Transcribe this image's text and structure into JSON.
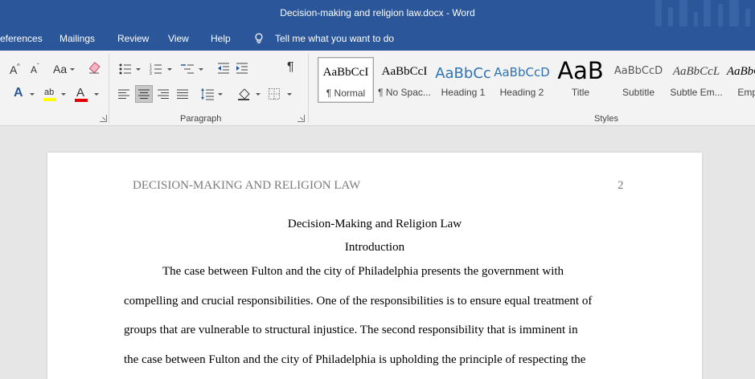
{
  "window": {
    "title": "Decision-making and religion law.docx  -  Word"
  },
  "tabs": {
    "references": "eferences",
    "mailings": "Mailings",
    "review": "Review",
    "view": "View",
    "help": "Help",
    "tell_me": "Tell me what you want to do"
  },
  "ribbon": {
    "font_group": {
      "grow_font": "A",
      "change_case": "Aa",
      "text_effects": "A",
      "highlight": "ab",
      "font_color": "A"
    },
    "paragraph_group": {
      "label": "Paragraph",
      "pilcrow": "¶"
    },
    "styles_group": {
      "label": "Styles",
      "items": [
        {
          "sample": "AaBbCcI",
          "name": "¶ Normal"
        },
        {
          "sample": "AaBbCcI",
          "name": "¶ No Spac..."
        },
        {
          "sample": "AaBbCc",
          "name": "Heading 1"
        },
        {
          "sample": "AaBbCcD",
          "name": "Heading 2"
        },
        {
          "sample": "AaB",
          "name": "Title"
        },
        {
          "sample": "AaBbCcD",
          "name": "Subtitle"
        },
        {
          "sample": "AaBbCcL",
          "name": "Subtle Em..."
        },
        {
          "sample": "AaBbCcL",
          "name": "Emph"
        }
      ]
    },
    "colors": {
      "highlight": "#ffff00",
      "font_color": "#e00000",
      "text_effects": "#2b579a",
      "heading_blue": "#2e74b5"
    }
  },
  "document": {
    "header": "DECISION-MAKING AND RELIGION LAW",
    "page_number": "2",
    "title": "Decision-Making and Religion Law",
    "heading": "Introduction",
    "lines": [
      "The case between Fulton and the city of Philadelphia presents the government with",
      "compelling and crucial responsibilities. One of the responsibilities is to ensure equal treatment of",
      "groups that are vulnerable to structural injustice. The second responsibility that is imminent in",
      "the case between Fulton and the city of Philadelphia is upholding the principle of respecting the"
    ]
  }
}
